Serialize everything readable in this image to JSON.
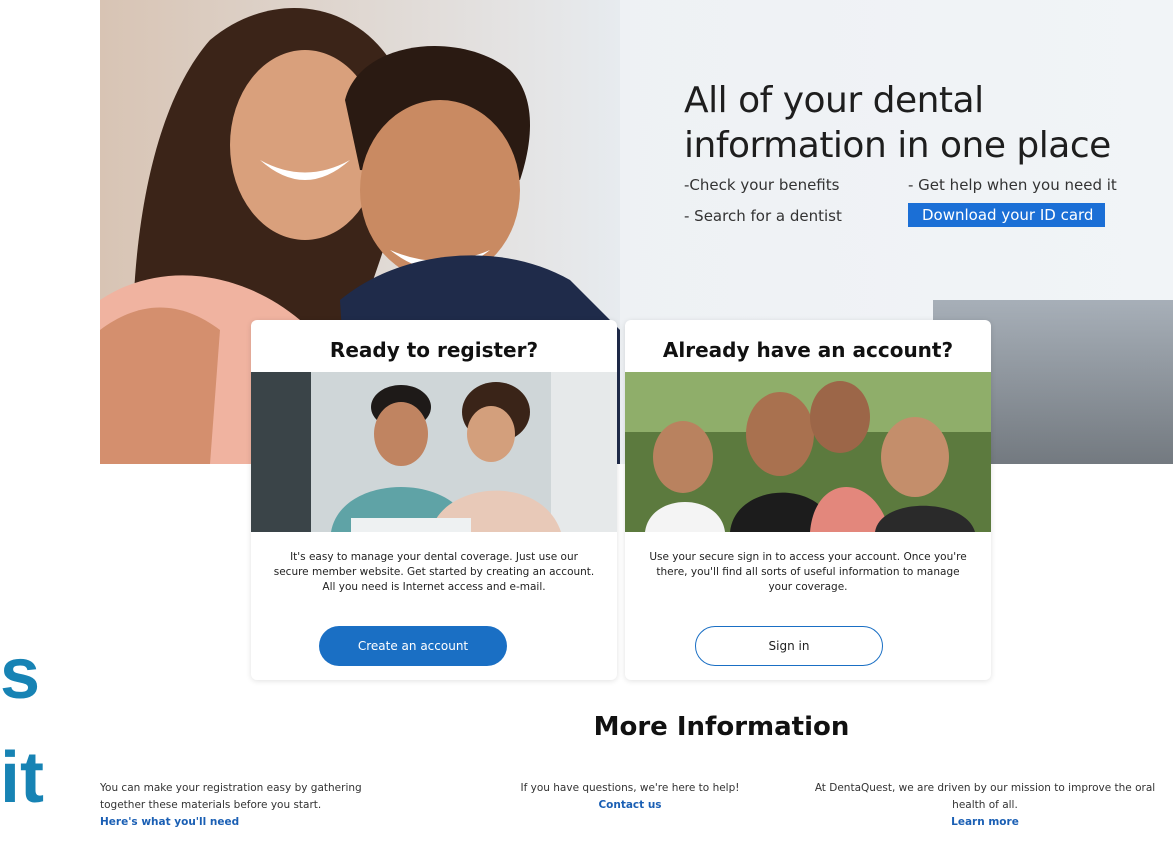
{
  "overlay": {
    "fragment_1": "s",
    "fragment_2": "it"
  },
  "hero": {
    "title": "All of your dental information in one place",
    "features": [
      "-Check your benefits",
      "- Search for a dentist",
      "- Get help when you need it",
      "Download your ID card"
    ]
  },
  "cards": {
    "register": {
      "title": "Ready to register?",
      "text": "It's easy to manage your dental coverage. Just use our secure member website. Get started by creating an account. All you need is Internet access and e-mail.",
      "button": "Create an account"
    },
    "signin": {
      "title": "Already have an account?",
      "text": "Use your secure sign in to access your account. Once you're there, you'll find all sorts of useful information to manage your coverage.",
      "button": "Sign in"
    }
  },
  "more_info": {
    "title": "More Information",
    "columns": [
      {
        "text": "You can make your registration easy by gathering together these materials before you start.",
        "link": "Here's what you'll need"
      },
      {
        "text": "If you have questions, we're here to help!",
        "link": "Contact us"
      },
      {
        "text": "At DentaQuest, we are driven by our mission to improve the oral health of all.",
        "link": "Learn more"
      }
    ]
  },
  "colors": {
    "accent": "#1a6fc4",
    "highlight": "#1b6fd6",
    "overlay_text": "#1783b4"
  }
}
